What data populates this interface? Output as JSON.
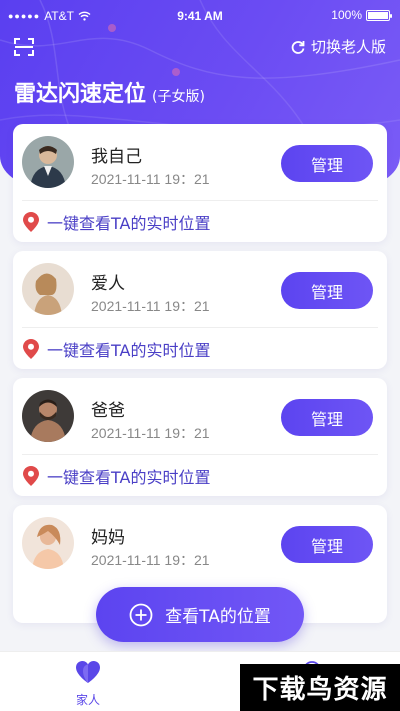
{
  "status_bar": {
    "signal_dots": "●●●●●",
    "carrier": "AT&T",
    "time": "9:41 AM",
    "battery": "100%",
    "battery_level": 1.0
  },
  "header": {
    "switch_label": "切换老人版",
    "title": "雷达闪速定位",
    "subtitle": "(子女版)"
  },
  "members": [
    {
      "name": "我自己",
      "time": "2021-11-11 19：21",
      "manage_label": "管理",
      "locate_label": "一键查看TA的实时位置"
    },
    {
      "name": "爱人",
      "time": "2021-11-11 19：21",
      "manage_label": "管理",
      "locate_label": "一键查看TA的实时位置"
    },
    {
      "name": "爸爸",
      "time": "2021-11-11 19：21",
      "manage_label": "管理",
      "locate_label": "一键查看TA的实时位置"
    },
    {
      "name": "妈妈",
      "time": "2021-11-11 19：21",
      "manage_label": "管理"
    }
  ],
  "fab": {
    "label": "查看TA的位置"
  },
  "tabbar": {
    "family_label": "家人"
  },
  "watermark": {
    "text": "下载鸟资源"
  },
  "colors": {
    "primary": "#5c44f0",
    "link": "#4a3fc6",
    "pin": "#e04a4a"
  },
  "icons": [
    "scan-icon",
    "refresh-icon",
    "location-pin-icon",
    "plus-circle-icon",
    "heart-icon"
  ]
}
